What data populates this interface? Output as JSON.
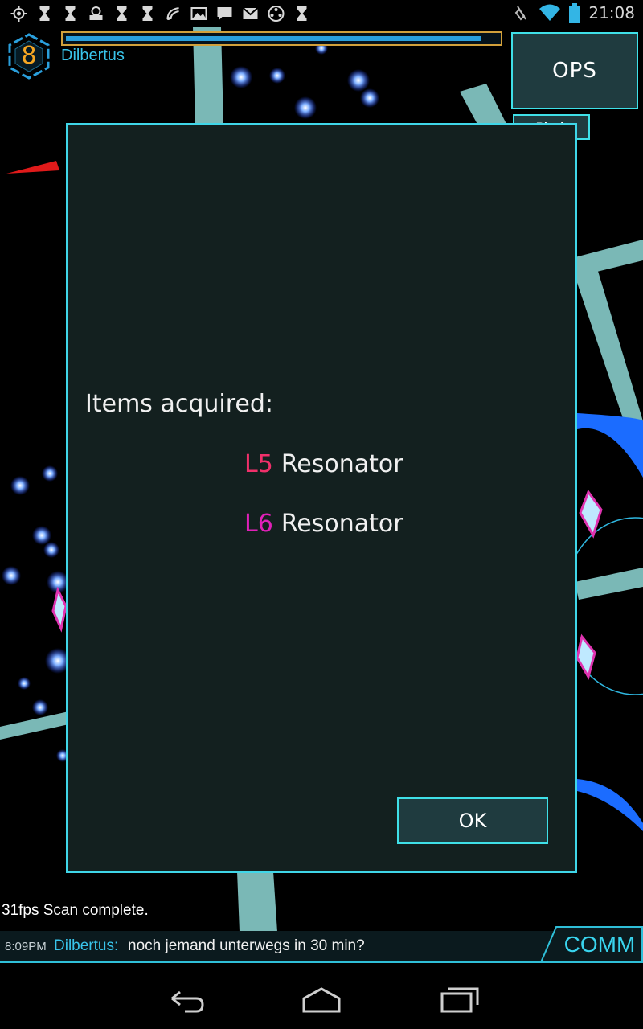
{
  "status_bar": {
    "left_icons": [
      "gps-icon",
      "hourglass-icon",
      "hourglass-icon",
      "ingress-app-icon",
      "hourglass-icon",
      "hourglass-icon",
      "wifi-scan-icon",
      "gallery-icon",
      "chat-icon",
      "gmail-icon",
      "film-icon",
      "hourglass-icon"
    ],
    "right_icons": [
      "vibrate-mute-icon",
      "wifi-icon",
      "battery-icon"
    ],
    "time": "21:08"
  },
  "player": {
    "level": "8",
    "name": "Dilbertus",
    "xp_fraction": 0.96
  },
  "buttons": {
    "ops": "OPS",
    "block": "Block"
  },
  "dialog": {
    "title": "Items acquired:",
    "items": [
      {
        "level": "L5",
        "name": "Resonator",
        "level_color": "#f0306a"
      },
      {
        "level": "L6",
        "name": "Resonator",
        "level_color": "#e020b8"
      }
    ],
    "ok_label": "OK"
  },
  "status_line": "31fps  Scan complete.",
  "comm": {
    "time": "8:09PM",
    "sender": "Dilbertus:",
    "message": "noch jemand unterwegs in 30 min?",
    "button_label": "COMM"
  },
  "colors": {
    "accent": "#3fe0e8",
    "player_blue": "#39c4ea",
    "level_orange": "#f5a623"
  }
}
